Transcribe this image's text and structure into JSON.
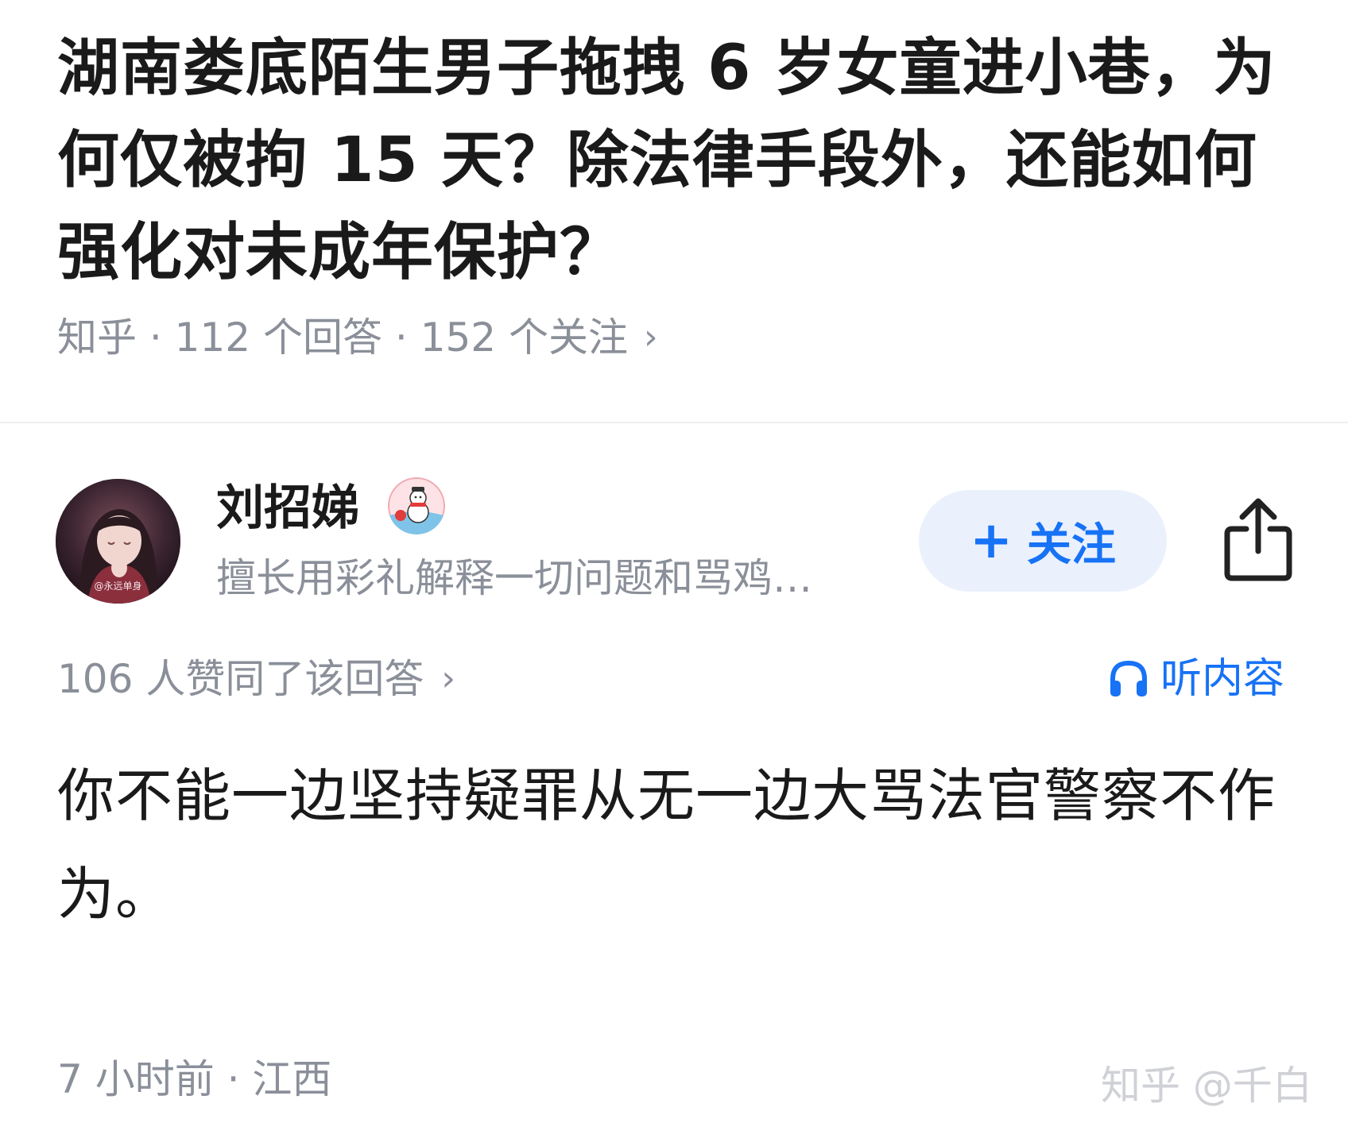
{
  "question": {
    "title": "湖南娄底陌生男子拖拽 6 岁女童进小巷，为何仅被拘 15 天？除法律手段外，还能如何强化对未成年保护？",
    "meta": "知乎 · 112 个回答 · 152 个关注",
    "meta_chevron": "›"
  },
  "author": {
    "name": "刘招娣",
    "bio": "擅长用彩礼解释一切问题和骂鸡…",
    "avatar_icon": "anime-girl-avatar",
    "avatar_caption": "@永远单身",
    "badge_icon": "snowman-badge-icon"
  },
  "actions": {
    "follow_plus": "+",
    "follow_label": "关注",
    "share_icon": "share-icon",
    "listen_label": "听内容",
    "listen_icon": "headphones-icon"
  },
  "answer": {
    "votes_text": "106 人赞同了该回答",
    "votes_chevron": "›",
    "content": "你不能一边坚持疑罪从无一边大骂法官警察不作为。",
    "time_location": "7 小时前 · 江西"
  },
  "watermark": "知乎 @千白",
  "colors": {
    "accent": "#1772f6",
    "follow_bg": "#eaf1fd",
    "meta_gray": "#8a8f99",
    "text": "#1a1a1a"
  }
}
